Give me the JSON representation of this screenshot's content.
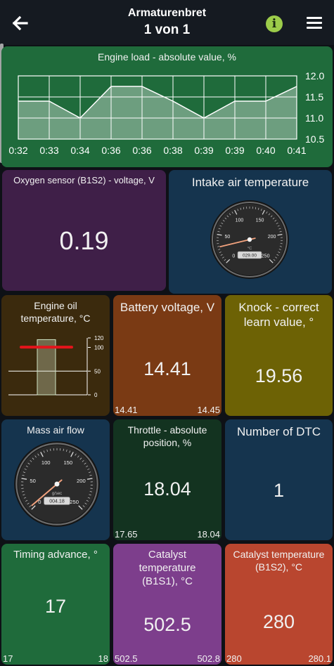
{
  "header": {
    "title": "Armaturenbret",
    "page_info": "1 von 1",
    "info_glyph": "i"
  },
  "colors": {
    "green": "#1f6b3b",
    "purple": "#3f1f48",
    "navy": "#15344e",
    "brown_dark": "#3b2a0d",
    "orange_brown": "#7a3a14",
    "olive": "#6d6205",
    "dark_green": "#133320",
    "violet": "#7d3e8c",
    "red": "#b9462f"
  },
  "tiles": {
    "engine_load": {
      "title": "Engine load - absolute value, %",
      "chart_data": {
        "type": "area",
        "title": "Engine load - absolute value, %",
        "x": [
          "0:32",
          "0:33",
          "0:34",
          "0:36",
          "0:36",
          "0:38",
          "0:39",
          "0:39",
          "0:40",
          "0:41"
        ],
        "y_ticks": [
          "12.0",
          "11.5",
          "11.0",
          "10.5"
        ],
        "ylim": [
          10.5,
          12.0
        ],
        "series": [
          {
            "values": [
              11.4,
              11.4,
              11.0,
              11.75,
              11.75,
              11.4,
              11.0,
              11.4,
              11.4,
              11.75
            ]
          }
        ]
      }
    },
    "oxygen": {
      "title": "Oxygen sensor (B1S2) - voltage, V",
      "value": "0.19"
    },
    "intake_air": {
      "title": "Intake air temperature",
      "gauge": {
        "ticks": [
          "0",
          "50",
          "100",
          "150",
          "200",
          "250"
        ],
        "unit": "°C",
        "readout": "029.00",
        "value": 29,
        "max": 250
      }
    },
    "engine_oil": {
      "title": "Engine oil temperature, °C",
      "bar": {
        "ticks": [
          "120",
          "100",
          "50",
          "0"
        ],
        "value": 100,
        "max": 120,
        "marker_value": 102
      }
    },
    "battery": {
      "title": "Battery voltage, V",
      "value": "14.41",
      "min": "14.41",
      "max": "14.45"
    },
    "knock": {
      "title": "Knock - correct learn value, °",
      "value": "19.56"
    },
    "maf": {
      "title": "Mass air flow",
      "gauge": {
        "ticks": [
          "0",
          "50",
          "100",
          "150",
          "200",
          "250"
        ],
        "unit": "g/sec",
        "readout": "004.18",
        "value": 4.18,
        "max": 250
      }
    },
    "throttle": {
      "title": "Throttle - absolute position, %",
      "value": "18.04",
      "min": "17.65",
      "max": "18.04"
    },
    "dtc": {
      "title": "Number of DTC",
      "value": "1"
    },
    "timing": {
      "title": "Timing advance, °",
      "value": "17",
      "min": "17",
      "max": "18"
    },
    "cat1": {
      "title": "Catalyst temperature (B1S1), °C",
      "value": "502.5",
      "min": "502.5",
      "max": "502.8"
    },
    "cat2": {
      "title": "Catalyst temperature (B1S2), °C",
      "value": "280",
      "min": "280",
      "max": "280.1"
    }
  }
}
